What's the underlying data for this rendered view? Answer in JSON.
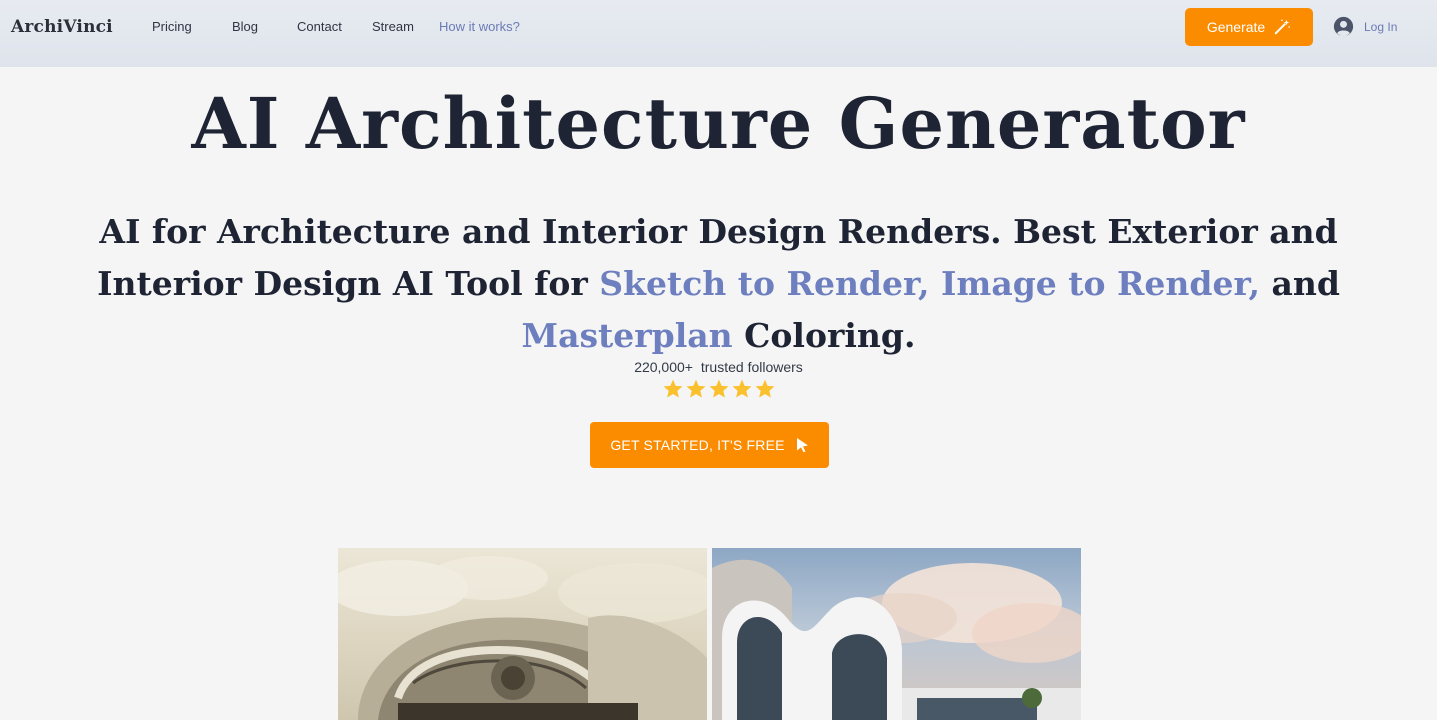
{
  "nav": {
    "logo": "ArchiVinci",
    "links": [
      "Pricing",
      "Blog",
      "Contact",
      "Stream",
      "How it works?"
    ],
    "generate_label": "Generate",
    "login_label": "Log In"
  },
  "hero": {
    "title": "AI Architecture Generator",
    "subtitle_part1": "AI for Architecture and Interior Design Renders. Best Exterior and Interior Design AI Tool for ",
    "highlight1": "Sketch to Render, Image to Render,",
    "subtitle_part2": " and ",
    "highlight2": "Masterplan",
    "subtitle_part3": " Coloring.",
    "followers_count": "220,000+",
    "followers_label": "trusted followers",
    "rating_stars": 5,
    "cta_label": "GET STARTED, IT'S FREE"
  },
  "colors": {
    "accent": "#fb8c00",
    "highlight": "#6e7fbf",
    "star": "#fbc02d",
    "text": "#1e2433"
  },
  "icons": [
    "magic-wand-icon",
    "user-avatar-icon",
    "star-icon",
    "cursor-arrow-icon"
  ]
}
